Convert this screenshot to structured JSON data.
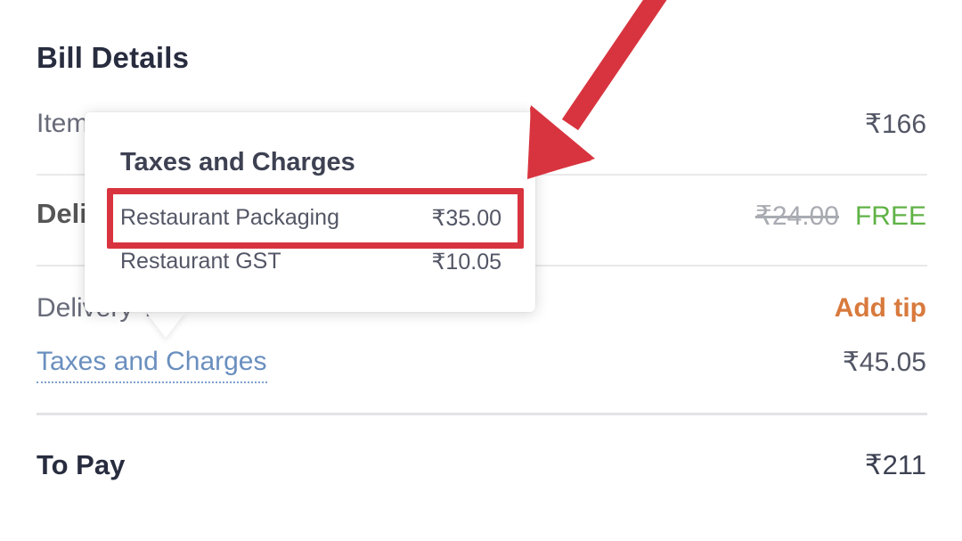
{
  "bill": {
    "title": "Bill Details",
    "item_total_label": "Item Total",
    "item_total_value": "₹166",
    "delivery_fee_label": "Delivery Fee",
    "delivery_fee_strike": "₹24.00",
    "delivery_fee_free": "FREE",
    "delivery_tip_label": "Delivery Tip",
    "add_tip": "Add tip",
    "taxes_label": "Taxes and Charges",
    "taxes_value": "₹45.05",
    "to_pay_label": "To Pay",
    "to_pay_value": "₹211"
  },
  "tooltip": {
    "title": "Taxes and Charges",
    "rows": [
      {
        "label": "Restaurant Packaging",
        "amount": "₹35.00"
      },
      {
        "label": "Restaurant GST",
        "amount": "₹10.05"
      }
    ]
  },
  "colors": {
    "annotation_red": "#d8343f",
    "free_green": "#60b246",
    "tip_orange": "#d87a3d",
    "link_blue": "#6a8fbf"
  }
}
